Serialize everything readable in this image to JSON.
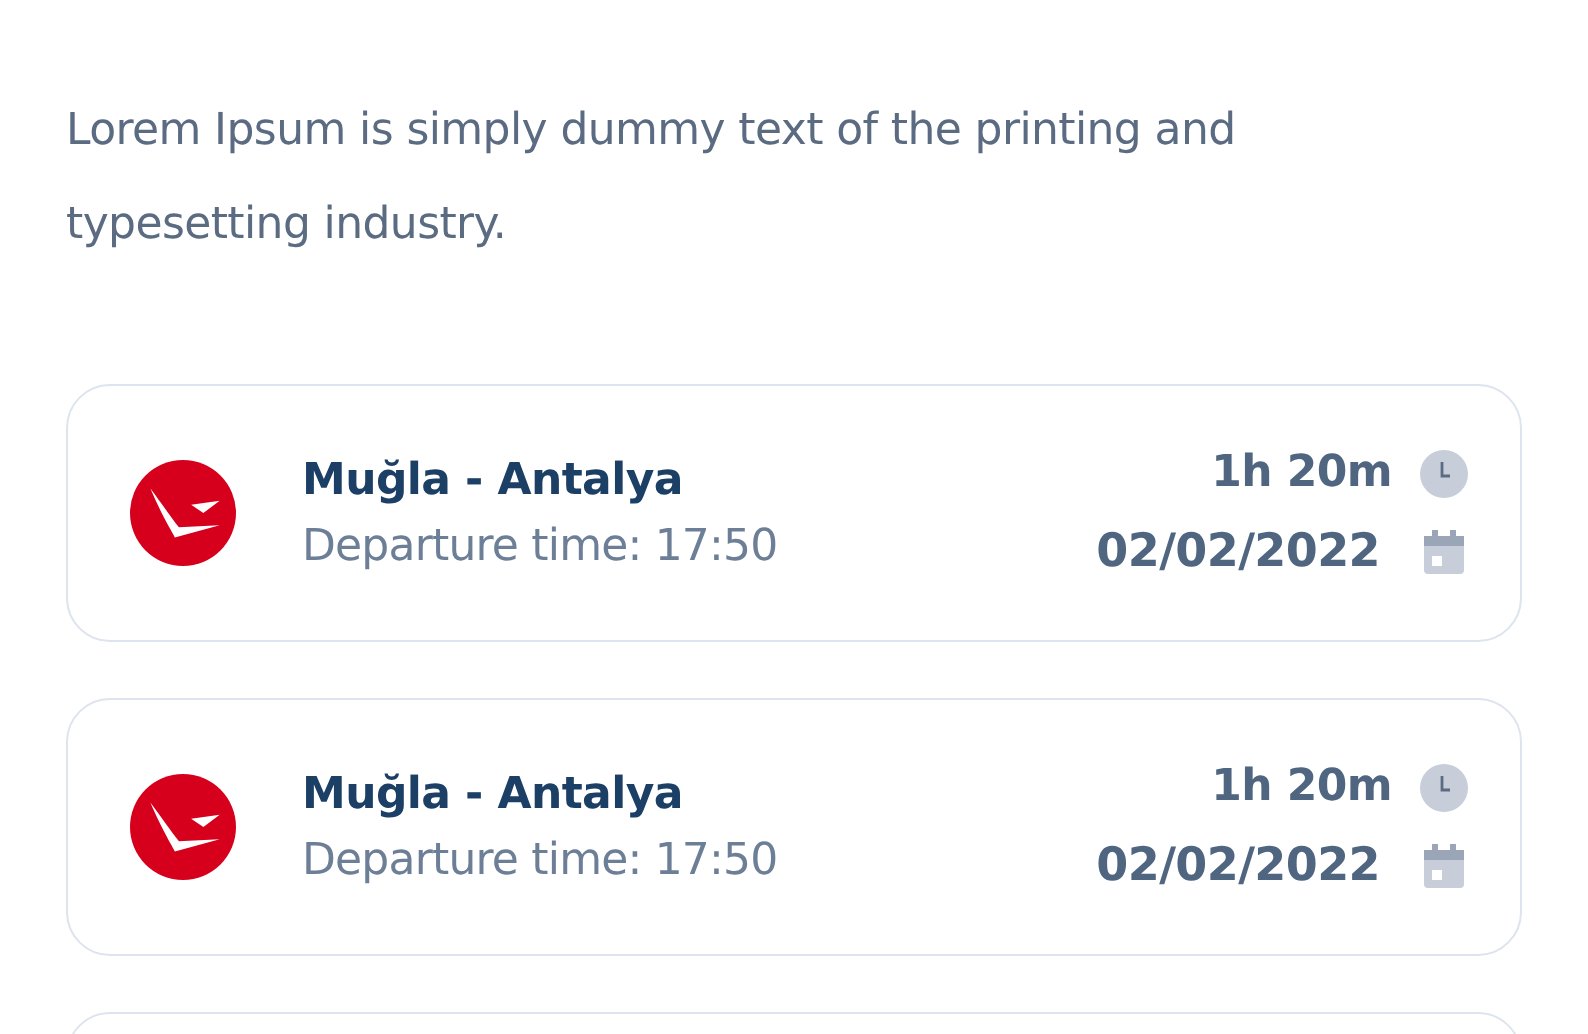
{
  "intro": "Lorem Ipsum is simply dummy text of the printing and typesetting industry.",
  "flights": [
    {
      "route": "Muğla - Antalya",
      "departure": "Departure time: 17:50",
      "duration": "1h 20m",
      "date": "02/02/2022"
    },
    {
      "route": "Muğla - Antalya",
      "departure": "Departure time: 17:50",
      "duration": "1h 20m",
      "date": "02/02/2022"
    }
  ]
}
